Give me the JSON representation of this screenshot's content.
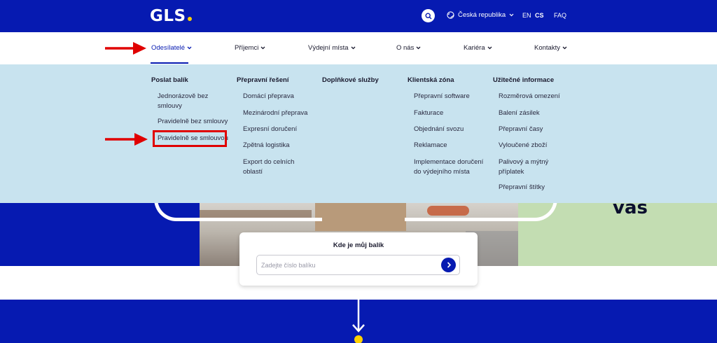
{
  "brand": {
    "logo": "GLS",
    "primary_color": "#061AB1",
    "accent_color": "#FFD100"
  },
  "topbar": {
    "search_icon": "search-icon",
    "country_icon": "globe-icon",
    "country": "Česká republika",
    "lang_en": "EN",
    "lang_cs": "CS",
    "faq": "FAQ"
  },
  "nav": {
    "items": [
      {
        "label": "Odesílatelé",
        "active": true
      },
      {
        "label": "Příjemci"
      },
      {
        "label": "Výdejní místa"
      },
      {
        "label": "O nás"
      },
      {
        "label": "Kariéra"
      },
      {
        "label": "Kontakty"
      }
    ]
  },
  "mega_menu": {
    "columns": [
      {
        "heading": "Poslat balík",
        "items": [
          "Jednorázově bez smlouvy",
          "Pravidelně bez smlouvy",
          "Pravidelně se smlouvou"
        ]
      },
      {
        "heading": "Přepravní řešení",
        "items": [
          "Domácí přeprava",
          "Mezinárodní přeprava",
          "Expresní doručení",
          "Zpětná logistika",
          "Export do celních oblastí"
        ]
      },
      {
        "heading": "Doplňkové služby",
        "items": []
      },
      {
        "heading": "Klientská zóna",
        "items": [
          "Přepravní software",
          "Fakturace",
          "Objednání svozu",
          "Reklamace",
          "Implementace doručení do výdejního místa"
        ]
      },
      {
        "heading": "Užitečné informace",
        "items": [
          "Rozměrová omezení",
          "Balení zásilek",
          "Přepravní časy",
          "Vyloučené zboží",
          "Palivový a mýtný příplatek",
          "Přepravní štítky"
        ]
      }
    ]
  },
  "hero": {
    "partial_text": "vás"
  },
  "tracking": {
    "title": "Kde je můj balík",
    "placeholder": "Zadejte číslo balíku",
    "submit_icon": "chevron-right-icon"
  },
  "annotations": {
    "color": "#E00000"
  }
}
